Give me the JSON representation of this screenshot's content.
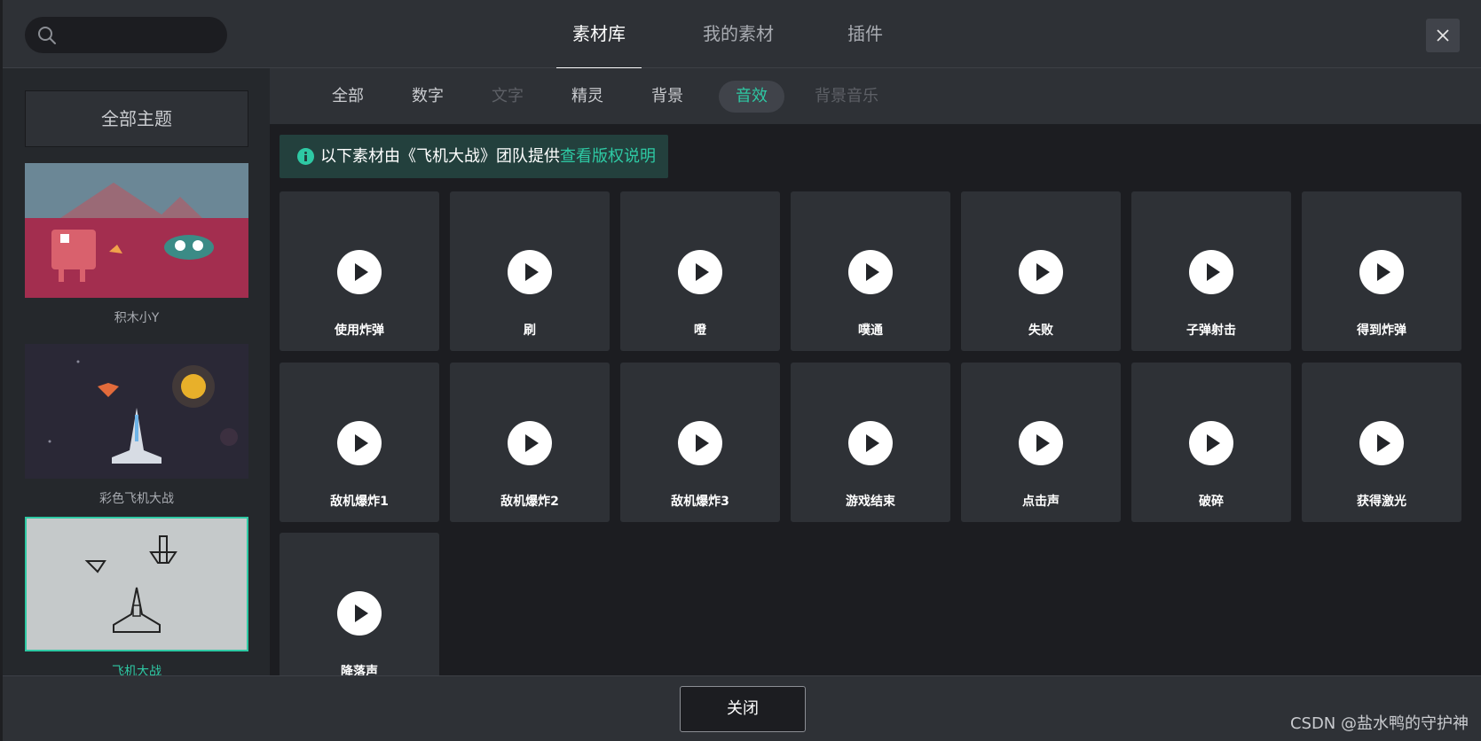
{
  "header": {
    "search_placeholder": "",
    "tabs": [
      {
        "label": "素材库",
        "active": true
      },
      {
        "label": "我的素材",
        "active": false
      },
      {
        "label": "插件",
        "active": false
      }
    ]
  },
  "sidebar": {
    "all_themes_label": "全部主题",
    "themes": [
      {
        "label": "积木小Y",
        "selected": false
      },
      {
        "label": "彩色飞机大战",
        "selected": false
      },
      {
        "label": "飞机大战",
        "selected": true
      }
    ]
  },
  "filters": [
    {
      "label": "全部",
      "state": "normal"
    },
    {
      "label": "数字",
      "state": "normal"
    },
    {
      "label": "文字",
      "state": "disabled"
    },
    {
      "label": "精灵",
      "state": "normal"
    },
    {
      "label": "背景",
      "state": "normal"
    },
    {
      "label": "音效",
      "state": "active"
    },
    {
      "label": "背景音乐",
      "state": "disabled"
    }
  ],
  "notice": {
    "text": "以下素材由《飞机大战》团队提供",
    "link": "查看版权说明"
  },
  "sounds": [
    "使用炸弹",
    "刷",
    "噔",
    "噗通",
    "失败",
    "子弹射击",
    "得到炸弹",
    "敌机爆炸1",
    "敌机爆炸2",
    "敌机爆炸3",
    "游戏结束",
    "点击声",
    "破碎",
    "获得激光",
    "降落声"
  ],
  "footer": {
    "close_label": "关闭",
    "watermark": "CSDN @盐水鸭的守护神"
  },
  "colors": {
    "accent": "#2ec9a4",
    "panel": "#2e3136",
    "background": "#1c1d21"
  }
}
